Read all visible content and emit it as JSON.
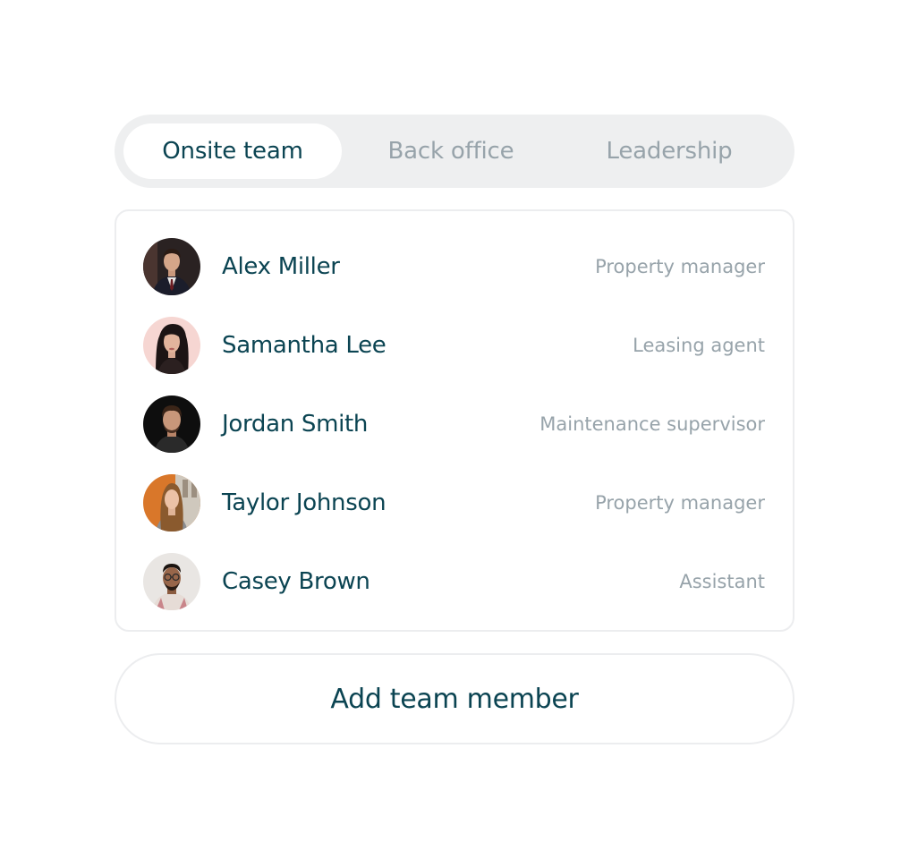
{
  "tabs": [
    {
      "label": "Onsite team",
      "active": true
    },
    {
      "label": "Back office",
      "active": false
    },
    {
      "label": "Leadership",
      "active": false
    }
  ],
  "members": [
    {
      "name": "Alex Miller",
      "role": "Property manager",
      "avatar_bg": "#2a2222"
    },
    {
      "name": "Samantha Lee",
      "role": "Leasing agent",
      "avatar_bg": "#f6d6d2"
    },
    {
      "name": "Jordan Smith",
      "role": "Maintenance supervisor",
      "avatar_bg": "#0e0e0e"
    },
    {
      "name": "Taylor Johnson",
      "role": "Property manager",
      "avatar_bg": "#d9772a"
    },
    {
      "name": "Casey Brown",
      "role": "Assistant",
      "avatar_bg": "#e9e6e3"
    }
  ],
  "add_button": {
    "label": "Add team member"
  },
  "colors": {
    "primary_text": "#0b4452",
    "muted_text": "#97a3aa",
    "tab_track": "#eeeff0",
    "border": "#ecedef"
  }
}
